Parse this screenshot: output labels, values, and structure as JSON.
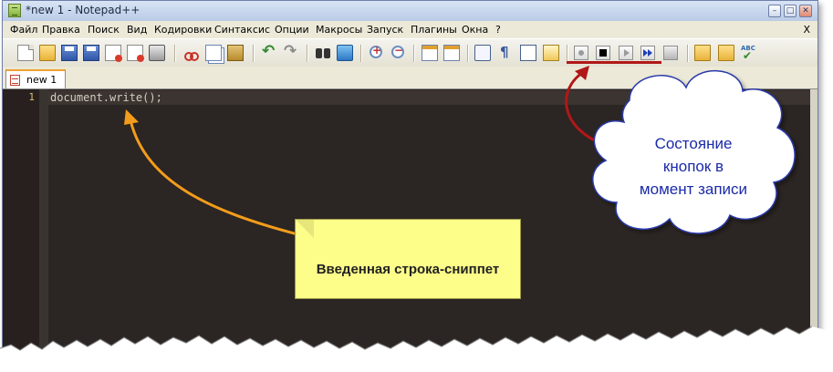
{
  "window": {
    "title": "*new  1 - Notepad++",
    "minimize_glyph": "–",
    "maximize_glyph": "□",
    "close_glyph": "✕"
  },
  "menu": {
    "items": [
      "Файл",
      "Правка",
      "Поиск",
      "Вид",
      "Кодировки",
      "Синтаксис",
      "Опции",
      "Макросы",
      "Запуск",
      "Плагины",
      "Окна",
      "?"
    ],
    "close_label": "X"
  },
  "toolbar": {
    "icons": [
      "new-file-icon",
      "open-folder-icon",
      "save-icon",
      "save-all-icon",
      "close-icon",
      "close-all-icon",
      "print-icon",
      "cut-icon",
      "copy-icon",
      "paste-icon",
      "undo-icon",
      "redo-icon",
      "find-icon",
      "replace-icon",
      "zoom-in-icon",
      "zoom-out-icon",
      "sync-vertical-icon",
      "sync-horizontal-icon",
      "word-wrap-icon",
      "show-all-chars-icon",
      "indent-guide-icon",
      "user-language-icon",
      "macro-record-icon",
      "macro-stop-icon",
      "macro-playback-icon",
      "macro-run-multiple-icon",
      "macro-save-icon",
      "folder-as-workspace-icon",
      "function-list-icon",
      "spell-check-icon"
    ]
  },
  "tabs": [
    {
      "label": "new  1",
      "active": true
    }
  ],
  "editor": {
    "line_number": "1",
    "code": "document.write();",
    "background": "#2b2523",
    "text_color": "#d2cdc2"
  },
  "annotations": {
    "snippet_note": "Введенная строка-сниппет",
    "cloud_lines": [
      "Состояние",
      "кнопок в",
      "момент записи"
    ],
    "arrow_orange": "#f39c1b",
    "arrow_red": "#b11818",
    "cloud_text_color": "#1b2aa8"
  }
}
